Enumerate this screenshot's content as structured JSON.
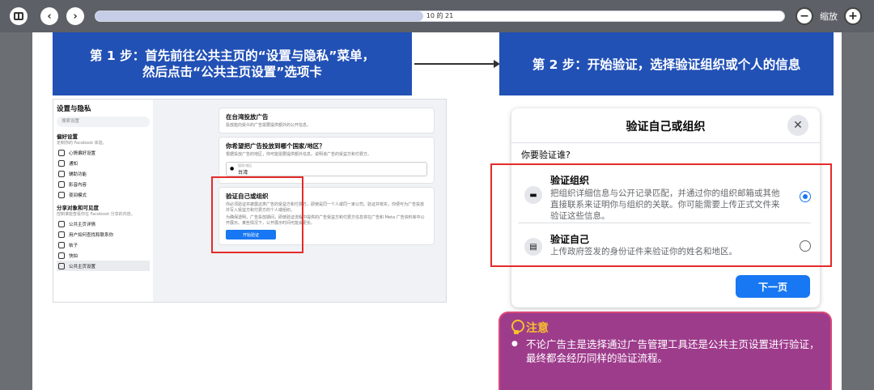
{
  "toolbar": {
    "progress_text": "10 的 21",
    "progress_fraction": 0.476,
    "zoom_label": "缩放",
    "zoom_out": "−",
    "zoom_in": "+",
    "prev": "‹",
    "next": "›"
  },
  "slide": {
    "step1_line1": "第 1 步：首先前往公共主页的“设置与隐私”菜单，",
    "step1_line2": "然后点击“公共主页设置”选项卡",
    "step2": "第 2 步：开始验证，选择验证组织或个人的信息",
    "left_shot": {
      "side_title": "设置与隐私",
      "search_placeholder": "搜索设置",
      "pref_heading": "偏好设置",
      "pref_sub": "定制你的 Facebook 体验。",
      "pref_items": [
        "心情偏好设置",
        "通知",
        "辅助功能",
        "影音内容",
        "夜间模式"
      ],
      "audience_heading": "分享对象和可见度",
      "audience_sub": "控制谁能查看你在 Facebook 分享的内容。",
      "audience_items": [
        "公共主页详情",
        "用户如何查找和联系你",
        "帖子",
        "快拍",
        "公共主页设置"
      ],
      "p1_title": "在台湾投放广告",
      "p1_sub": "投放能向受众的广告需要提供额外的公开信息。",
      "p2_title": "你希望把广告投放到哪个国家/地区？",
      "p2_sub": "根据投放广告的地区，你可能需要提供额外信息。说明该广告的受益方和付费方。",
      "p2_field_label": "国家/地区",
      "p2_field_value": "台湾",
      "p3_title": "验证自己或组织",
      "p3_sub1": "你必须验证并披露这类广告的受益方和付费方，即使是同一个人或同一家公司。验证并核实，你便可为广告投放并写入受益方和付费方的个人或组织。",
      "p3_sub2": "为确保透明，广告投放期间，即使验证流程中提供的广告受益方和付费方信息将在广告和 Meta 广告资料库中公开展示。某些情况下，公开展示时间可能会更长。",
      "p3_button": "开始验证"
    },
    "dialog": {
      "title": "验证自己或组织",
      "question": "你要验证谁?",
      "option1_title": "验证组织",
      "option1_desc": "把组织详细信息与公开记录匹配，并通过你的组织邮箱或其他直接联系来证明你与组织的关联。你可能需要上传正式文件来验证这些信息。",
      "option1_selected": true,
      "option2_title": "验证自己",
      "option2_desc": "上传政府签发的身份证件来验证你的姓名和地区。",
      "option2_selected": false,
      "next_button": "下一页"
    },
    "note": {
      "title": "注意",
      "body": "不论广告主是选择通过广告管理工具还是公共主页设置进行验证，最终都会经历同样的验证流程。"
    }
  }
}
